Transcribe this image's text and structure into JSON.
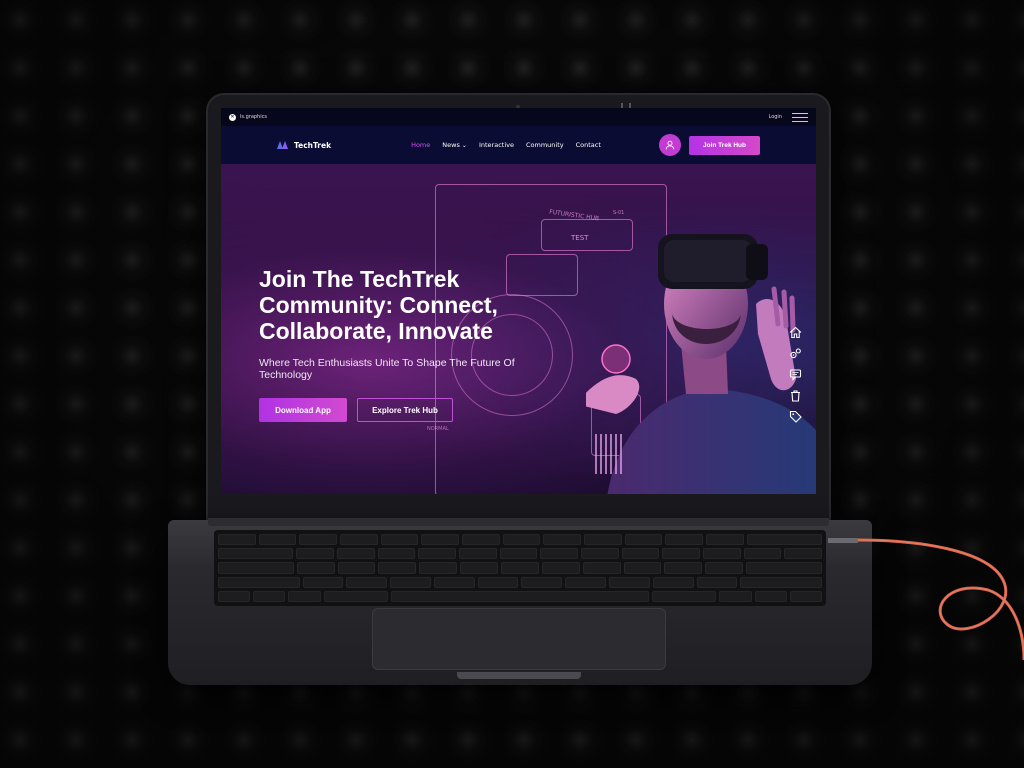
{
  "topbar": {
    "brand_badge": "✕",
    "brand_label": "ls.graphics",
    "login_label": "Login"
  },
  "navbar": {
    "logo_text": "TechTrek",
    "links": [
      {
        "label": "Home",
        "active": true
      },
      {
        "label": "News",
        "has_dropdown": true
      },
      {
        "label": "Interactive"
      },
      {
        "label": "Community"
      },
      {
        "label": "Contact"
      }
    ],
    "join_button": "Join Trek Hub"
  },
  "hero": {
    "title": "Join The TechTrek Community: Connect, Collaborate, Innovate",
    "subtitle": "Where Tech Enthusiasts Unite To Shape The Future Of Technology",
    "primary_button": "Download App",
    "secondary_button": "Explore Trek Hub",
    "holo_labels": [
      "FUTURISTIC HUB",
      "TEST",
      "S-01",
      "NORMAL"
    ]
  },
  "side_icons": [
    "home-icon",
    "gears-icon",
    "chat-icon",
    "trash-icon",
    "tag-icon"
  ],
  "colors": {
    "accent": "#c23cd4",
    "nav_bg": "#0b0c33",
    "hero_bg": "#3a1450",
    "cable": "#d9664f"
  }
}
